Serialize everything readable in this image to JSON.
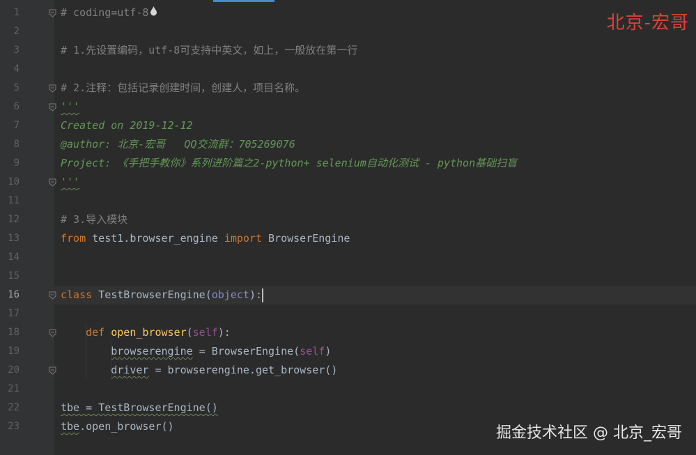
{
  "editor": {
    "lines": [
      {
        "num": "1",
        "segments": [
          {
            "t": "# coding=utf-8",
            "c": "c-comment"
          }
        ],
        "fold": true,
        "icon": "drop"
      },
      {
        "num": "2",
        "segments": []
      },
      {
        "num": "3",
        "segments": [
          {
            "t": "# 1.先设置编码，utf-8可支持中英文，如上，一般放在第一行",
            "c": "c-comment"
          }
        ]
      },
      {
        "num": "4",
        "segments": []
      },
      {
        "num": "5",
        "segments": [
          {
            "t": "# 2.注释：包括记录创建时间，创建人，项目名称。",
            "c": "c-comment"
          }
        ],
        "fold": true
      },
      {
        "num": "6",
        "segments": [
          {
            "t": "'''",
            "c": "c-doc squiggle"
          }
        ],
        "fold": true
      },
      {
        "num": "7",
        "segments": [
          {
            "t": "Created on 2019-12-12",
            "c": "c-doc"
          }
        ]
      },
      {
        "num": "8",
        "segments": [
          {
            "t": "@author: 北京-宏哥   QQ交流群：705269076",
            "c": "c-doc"
          }
        ]
      },
      {
        "num": "9",
        "segments": [
          {
            "t": "Project: 《手把手教你》系列进阶篇之2-python+ selenium自动化测试 - python基础扫盲",
            "c": "c-doc"
          }
        ]
      },
      {
        "num": "10",
        "segments": [
          {
            "t": "'''",
            "c": "c-doc squiggle"
          }
        ],
        "fold": true
      },
      {
        "num": "11",
        "segments": []
      },
      {
        "num": "12",
        "segments": [
          {
            "t": "# 3.导入模块",
            "c": "c-comment"
          }
        ]
      },
      {
        "num": "13",
        "segments": [
          {
            "t": "from",
            "c": "c-keyword"
          },
          {
            "t": " test1.browser_engine ",
            "c": "c-plain"
          },
          {
            "t": "import",
            "c": "c-keyword"
          },
          {
            "t": " BrowserEngine",
            "c": "c-plain"
          }
        ]
      },
      {
        "num": "14",
        "segments": []
      },
      {
        "num": "15",
        "segments": []
      },
      {
        "num": "16",
        "segments": [
          {
            "t": "class",
            "c": "c-keyword"
          },
          {
            "t": " TestBrowserEngine",
            "c": "c-plain"
          },
          {
            "t": "(",
            "c": "c-plain"
          },
          {
            "t": "object",
            "c": "c-builtin"
          },
          {
            "t": "):",
            "c": "c-plain"
          }
        ],
        "fold": true,
        "current": true,
        "caret": true
      },
      {
        "num": "17",
        "segments": []
      },
      {
        "num": "18",
        "segments": [
          {
            "t": "    ",
            "c": "c-plain"
          },
          {
            "t": "def",
            "c": "c-keyword"
          },
          {
            "t": " ",
            "c": "c-plain"
          },
          {
            "t": "open_browser",
            "c": "c-fn"
          },
          {
            "t": "(",
            "c": "c-plain"
          },
          {
            "t": "self",
            "c": "c-self"
          },
          {
            "t": "):",
            "c": "c-plain"
          }
        ],
        "fold": true
      },
      {
        "num": "19",
        "segments": [
          {
            "t": "        ",
            "c": "c-plain"
          },
          {
            "t": "browserengine",
            "c": "c-plain squiggle"
          },
          {
            "t": " = BrowserEngine(",
            "c": "c-plain"
          },
          {
            "t": "self",
            "c": "c-self"
          },
          {
            "t": ")",
            "c": "c-plain"
          }
        ]
      },
      {
        "num": "20",
        "segments": [
          {
            "t": "        ",
            "c": "c-plain"
          },
          {
            "t": "driver",
            "c": "c-plain squiggle"
          },
          {
            "t": " = browserengine.get_browser()",
            "c": "c-plain"
          }
        ],
        "fold": true
      },
      {
        "num": "21",
        "segments": []
      },
      {
        "num": "22",
        "segments": [
          {
            "t": "tbe = TestBrowserEngine()",
            "c": "c-plain squiggle"
          }
        ]
      },
      {
        "num": "23",
        "segments": [
          {
            "t": "tbe",
            "c": "c-plain squiggle"
          },
          {
            "t": ".open_browser()",
            "c": "c-plain"
          }
        ]
      }
    ]
  },
  "watermark": {
    "top": "北京-宏哥",
    "bottom": "掘金技术社区 @ 北京_宏哥"
  },
  "colors": {
    "background": "#2b2b2b",
    "gutter": "#313335",
    "accent": "#4a88c7",
    "watermark_red": "#e0403a"
  }
}
